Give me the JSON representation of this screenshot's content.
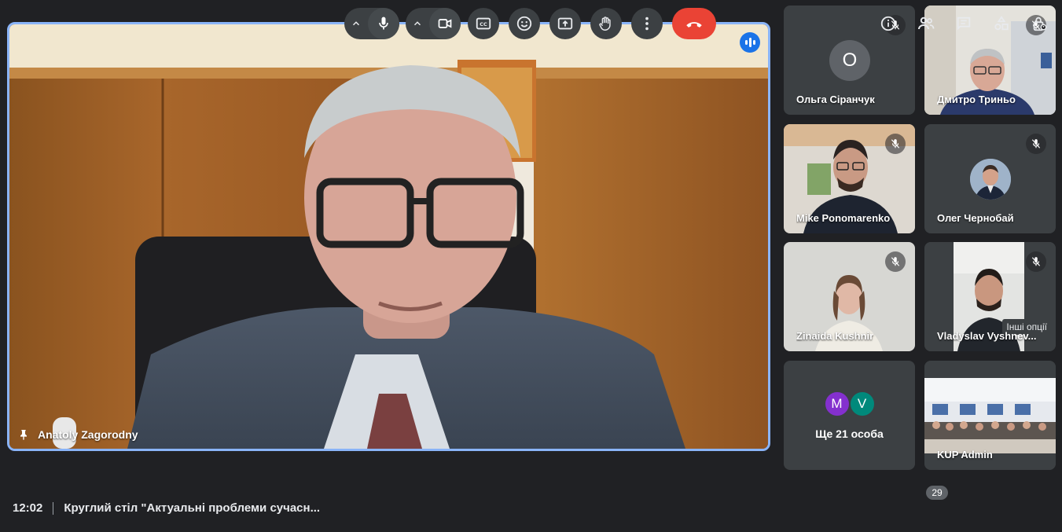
{
  "main_speaker": {
    "name": "Anatoly Zagorodny",
    "pinned": true,
    "speaking": true
  },
  "participants": [
    {
      "name": "Ольга Сіранчук",
      "avatar_letter": "О",
      "muted": true,
      "type": "avatar"
    },
    {
      "name": "Дмитро Триньо",
      "muted": true,
      "type": "video"
    },
    {
      "name": "Mike Ponomarenko",
      "muted": true,
      "type": "video"
    },
    {
      "name": "Олег Чернобай",
      "muted": true,
      "type": "photo"
    },
    {
      "name": "Zinaida Kushnir",
      "muted": true,
      "type": "video"
    },
    {
      "name": "Vladyslav Vyshnev...",
      "muted": true,
      "type": "video",
      "tooltip": "Інші опції"
    },
    {
      "type": "more",
      "avatars": [
        {
          "letter": "M",
          "color": "#8430ce"
        },
        {
          "letter": "V",
          "color": "#00897b"
        }
      ],
      "label": "Ще 21 особа"
    },
    {
      "name": "KUP Admin",
      "type": "video"
    }
  ],
  "meeting": {
    "time": "12:02",
    "title": "Круглий стіл \"Актуальні проблеми сучасн..."
  },
  "controls": {
    "mic": "mic-icon",
    "camera": "videocam-icon",
    "captions": "closed-captions-icon",
    "reactions": "emoji-icon",
    "present": "present-screen-icon",
    "raise_hand": "hand-icon",
    "more": "more-vert-icon",
    "end_call": "call-end-icon"
  },
  "right_panel": {
    "people_count": "29"
  },
  "colors": {
    "background": "#202124",
    "tile": "#3c4043",
    "active_border": "#8ab4f8",
    "end_call": "#ea4335",
    "speaking": "#1a73e8"
  }
}
